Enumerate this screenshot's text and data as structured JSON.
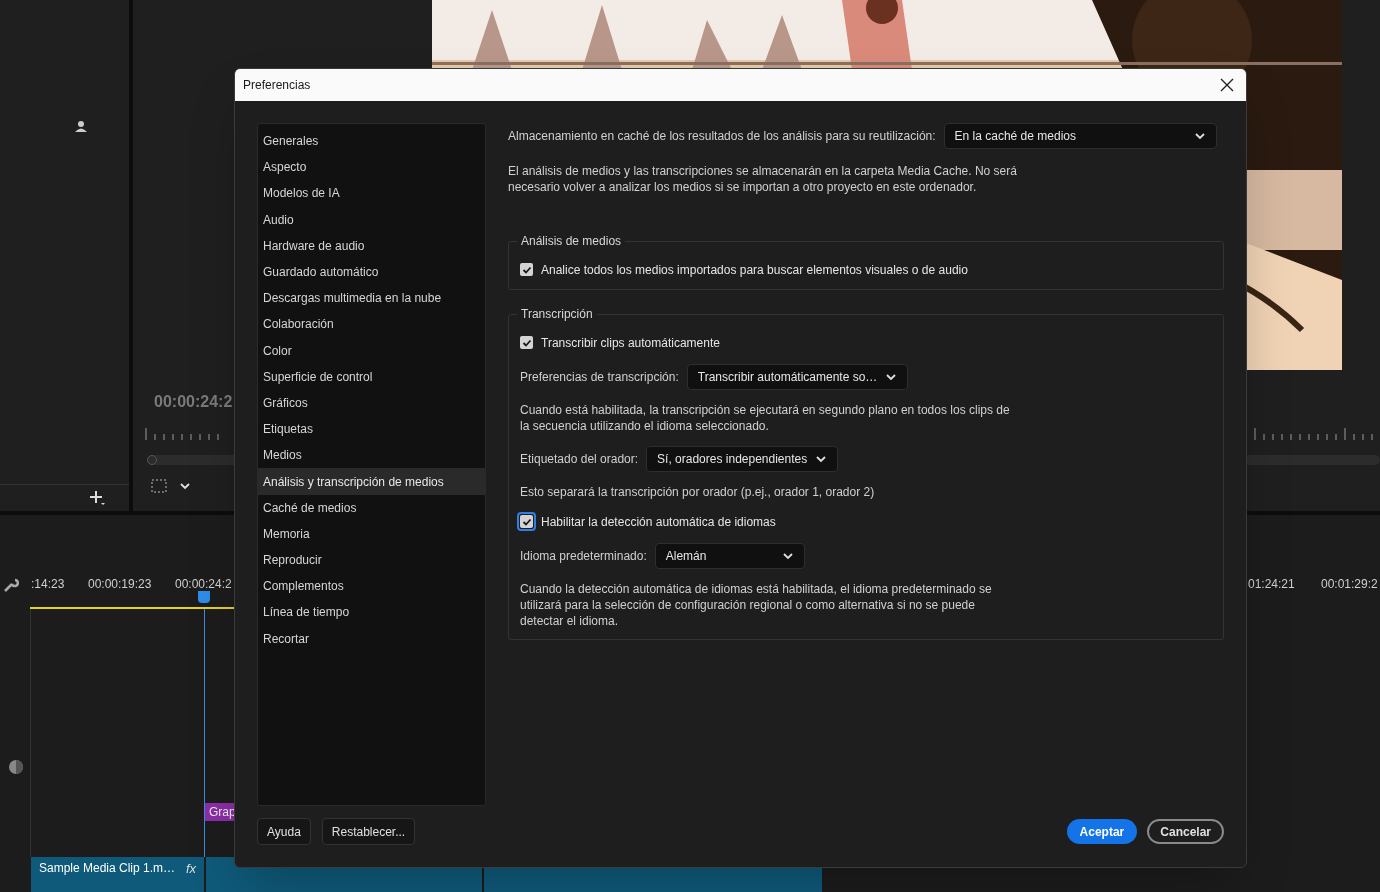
{
  "background": {
    "monitor_timecode": "00:00:24:2",
    "timeline_timecodes": [
      ":14:23",
      "00:00:19:23",
      "00:00:24:2"
    ],
    "timeline_timecodes_right": [
      "01:24:21",
      "00:01:29:2"
    ],
    "graphic_clip": "Grap",
    "clips": [
      {
        "label": "Sample Media Clip 1.m…",
        "fx": "fx"
      }
    ]
  },
  "dialog": {
    "title": "Preferencias",
    "sidebar": [
      {
        "label": "Generales",
        "selected": false
      },
      {
        "label": "Aspecto",
        "selected": false
      },
      {
        "label": "Modelos de IA",
        "selected": false
      },
      {
        "label": "Audio",
        "selected": false
      },
      {
        "label": "Hardware de audio",
        "selected": false
      },
      {
        "label": "Guardado automático",
        "selected": false
      },
      {
        "label": "Descargas multimedia en la nube",
        "selected": false
      },
      {
        "label": "Colaboración",
        "selected": false
      },
      {
        "label": "Color",
        "selected": false
      },
      {
        "label": "Superficie de control",
        "selected": false
      },
      {
        "label": "Gráficos",
        "selected": false
      },
      {
        "label": "Etiquetas",
        "selected": false
      },
      {
        "label": "Medios",
        "selected": false
      },
      {
        "label": "Análisis y transcripción de medios",
        "selected": true
      },
      {
        "label": "Caché de medios",
        "selected": false
      },
      {
        "label": "Memoria",
        "selected": false
      },
      {
        "label": "Reproducir",
        "selected": false
      },
      {
        "label": "Complementos",
        "selected": false
      },
      {
        "label": "Línea de tiempo",
        "selected": false
      },
      {
        "label": "Recortar",
        "selected": false
      }
    ],
    "cache": {
      "label": "Almacenamiento en caché de los resultados de los análisis para su reutilización:",
      "value": "En la caché de medios"
    },
    "cache_note": "El análisis de medios y las transcripciones se almacenarán en la carpeta Media Cache. No será necesario volver a analizar los medios si se importan a otro proyecto en este ordenador.",
    "sections": [
      {
        "title": "Análisis de medios",
        "items": [
          {
            "kind": "checkbox",
            "label": "Analice todos los medios importados para buscar elementos visuales o de audio",
            "checked": true,
            "focused": false
          }
        ]
      },
      {
        "title": "Transcripción",
        "items": [
          {
            "kind": "checkbox",
            "label": "Transcribir clips automáticamente",
            "checked": true,
            "focused": false
          },
          {
            "kind": "dropdown",
            "label": "Preferencias de transcripción:",
            "value": "Transcribir automáticamente so…"
          },
          {
            "kind": "note",
            "text": "Cuando está habilitada, la transcripción se ejecutará en segundo plano en todos los clips de la secuencia utilizando el idioma seleccionado."
          },
          {
            "kind": "dropdown",
            "label": "Etiquetado del orador:",
            "value": "Sí, oradores independientes"
          },
          {
            "kind": "note",
            "text": "Esto separará la transcripción por orador (p.ej., orador 1, orador 2)"
          },
          {
            "kind": "checkbox",
            "label": "Habilitar la detección automática de idiomas",
            "checked": true,
            "focused": true
          },
          {
            "kind": "dropdown",
            "label": "Idioma predeterminado:",
            "value": "Alemán"
          },
          {
            "kind": "note",
            "text": "Cuando la detección automática de idiomas está habilitada, el idioma predeterminado se utilizará para la selección de configuración regional o como alternativa si no se puede detectar el idioma."
          }
        ]
      }
    ],
    "left_buttons": [
      {
        "label": "Ayuda",
        "kind": "secondary"
      },
      {
        "label": "Restablecer...",
        "kind": "secondary"
      }
    ],
    "right_buttons": [
      {
        "label": "Aceptar",
        "kind": "primary"
      },
      {
        "label": "Cancelar",
        "kind": "outline"
      }
    ]
  }
}
